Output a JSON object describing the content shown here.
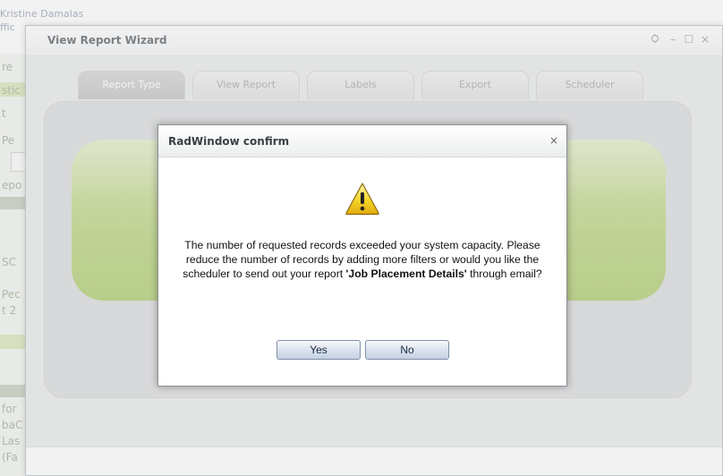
{
  "background": {
    "user_name": "Kristine Damalas",
    "office_fragment": "ffic",
    "fragments": [
      "re",
      "stic",
      "t",
      "Pe",
      "epo",
      "SC",
      "Pec",
      "t 2",
      "for",
      "baC",
      "Las",
      "(Fa"
    ]
  },
  "wizard": {
    "title": "View Report Wizard",
    "controls": {
      "pin_icon": "pin-icon",
      "minimize": "–",
      "maximize": "☐",
      "close": "×"
    },
    "tabs": [
      {
        "label": "Report Type",
        "active": true
      },
      {
        "label": "View Report",
        "active": false
      },
      {
        "label": "Labels",
        "active": false
      },
      {
        "label": "Export",
        "active": false
      },
      {
        "label": "Scheduler",
        "active": false
      }
    ]
  },
  "dialog": {
    "title": "RadWindow confirm",
    "close_label": "×",
    "icon": "warning-icon",
    "message_part1": "The number of requested records exceeded your system capacity. Please reduce the number of records by adding more filters or would you like the scheduler to send out your report ",
    "report_name": "'Job Placement Details'",
    "message_part2": " through email?",
    "yes_label": "Yes",
    "no_label": "No"
  },
  "colors": {
    "green_panel": "#a8c95e",
    "button_border": "#7f8fa8",
    "warning_yellow": "#f5d32a"
  }
}
